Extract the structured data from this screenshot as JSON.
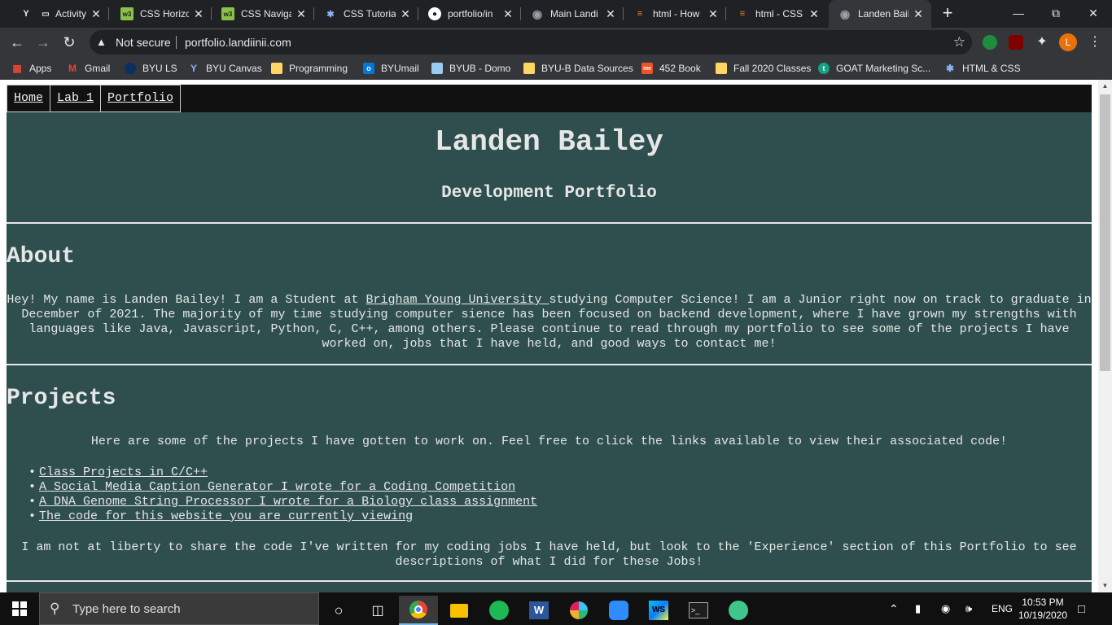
{
  "browser": {
    "tabs": [
      {
        "title": "Activity",
        "icon": "byu-icon",
        "color": "#e8eaed",
        "active": false
      },
      {
        "title": "CSS Horizo",
        "icon": "w3schools-icon",
        "color": "#8ac149",
        "active": false
      },
      {
        "title": "CSS Naviga",
        "icon": "w3schools-icon",
        "color": "#8ac149",
        "active": false
      },
      {
        "title": "CSS Tutoria",
        "icon": "code-icon",
        "color": "#8ab4f8",
        "active": false
      },
      {
        "title": "portfolio/in",
        "icon": "github-icon",
        "color": "#ffffff",
        "active": false
      },
      {
        "title": "Main Landi",
        "icon": "globe-icon",
        "color": "#9aa0a6",
        "active": false
      },
      {
        "title": "html - How",
        "icon": "stackoverflow-icon",
        "color": "#f48024",
        "active": false
      },
      {
        "title": "html - CSS",
        "icon": "stackoverflow-icon",
        "color": "#f48024",
        "active": false
      },
      {
        "title": "Landen Bail",
        "icon": "globe-icon",
        "color": "#9aa0a6",
        "active": true
      }
    ],
    "new_tab_glyph": "+",
    "security_label": "Not secure",
    "url": "portfolio.landiinii.com",
    "profile_initial": "L",
    "profile_color": "#e8710a",
    "bookmarks": [
      {
        "label": "Apps",
        "icon": "apps-grid-icon",
        "color": "#ea4335"
      },
      {
        "label": "Gmail",
        "icon": "gmail-icon",
        "color": "#ea4335"
      },
      {
        "label": "BYU LS",
        "icon": "byu-icon",
        "color": "#0b2e64"
      },
      {
        "label": "BYU Canvas",
        "icon": "byu-icon",
        "color": "#8ab4f8"
      },
      {
        "label": "Programming",
        "icon": "folder-icon",
        "color": "#fdd663"
      },
      {
        "label": "BYUmail",
        "icon": "outlook-icon",
        "color": "#0078d4"
      },
      {
        "label": "BYUB - Domo",
        "icon": "domo-icon",
        "color": "#99ccee"
      },
      {
        "label": "BYU-B Data Sources",
        "icon": "folder-icon",
        "color": "#fdd663"
      },
      {
        "label": "452 Book",
        "icon": "book-icon",
        "color": "#f0512b"
      },
      {
        "label": "Fall 2020 Classes",
        "icon": "folder-icon",
        "color": "#fdd663"
      },
      {
        "label": "GOAT Marketing Sc...",
        "icon": "goat-icon",
        "color": "#16a085"
      },
      {
        "label": "HTML & CSS",
        "icon": "code-icon",
        "color": "#8ab4f8"
      }
    ]
  },
  "site": {
    "nav": [
      "Home",
      "Lab 1",
      "Portfolio"
    ],
    "title": "Landen Bailey",
    "subtitle": "Development Portfolio",
    "about": {
      "heading": "About",
      "before_link": "Hey! My name is Landen Bailey! I am a Student at ",
      "link": "Brigham Young University ",
      "after_link": "studying Computer Science! I am a Junior right now on track to graduate in December of 2021. The majority of my time studying computer sience has been focused on backend development, where I have grown my strengths with languages like Java, Javascript, Python, C, C++, among others. Please continue to read through my portfolio to see some of the projects I have worked on, jobs that I have held, and good ways to contact me!"
    },
    "projects": {
      "heading": "Projects",
      "intro": "Here are some of the projects I have gotten to work on. Feel free to click the links available to view their associated code!",
      "items": [
        "Class Projects in C/C++",
        "A Social Media Caption Generator I wrote for a Coding Competition",
        "A DNA Genome String Processor I wrote for a Biology class assignment",
        "The code for this website you are currently viewing"
      ],
      "note": "I am not at liberty to share the code I've written for my coding jobs I have held, but look to the 'Experience' section of this Portfolio to see descriptions of what I did for these Jobs!"
    },
    "colors": {
      "background": "#2f4f4f",
      "nav": "#111111",
      "text": "#e6e6e6"
    }
  },
  "taskbar": {
    "search_placeholder": "Type here to search",
    "apps": [
      {
        "name": "task-view-icon"
      },
      {
        "name": "chrome-icon",
        "active": true
      },
      {
        "name": "file-explorer-icon"
      },
      {
        "name": "spotify-icon"
      },
      {
        "name": "word-icon"
      },
      {
        "name": "slack-icon"
      },
      {
        "name": "zoom-icon"
      },
      {
        "name": "webstorm-icon"
      },
      {
        "name": "terminal-icon"
      },
      {
        "name": "atom-icon"
      }
    ],
    "language": "ENG",
    "time": "10:53 PM",
    "date": "10/19/2020"
  }
}
